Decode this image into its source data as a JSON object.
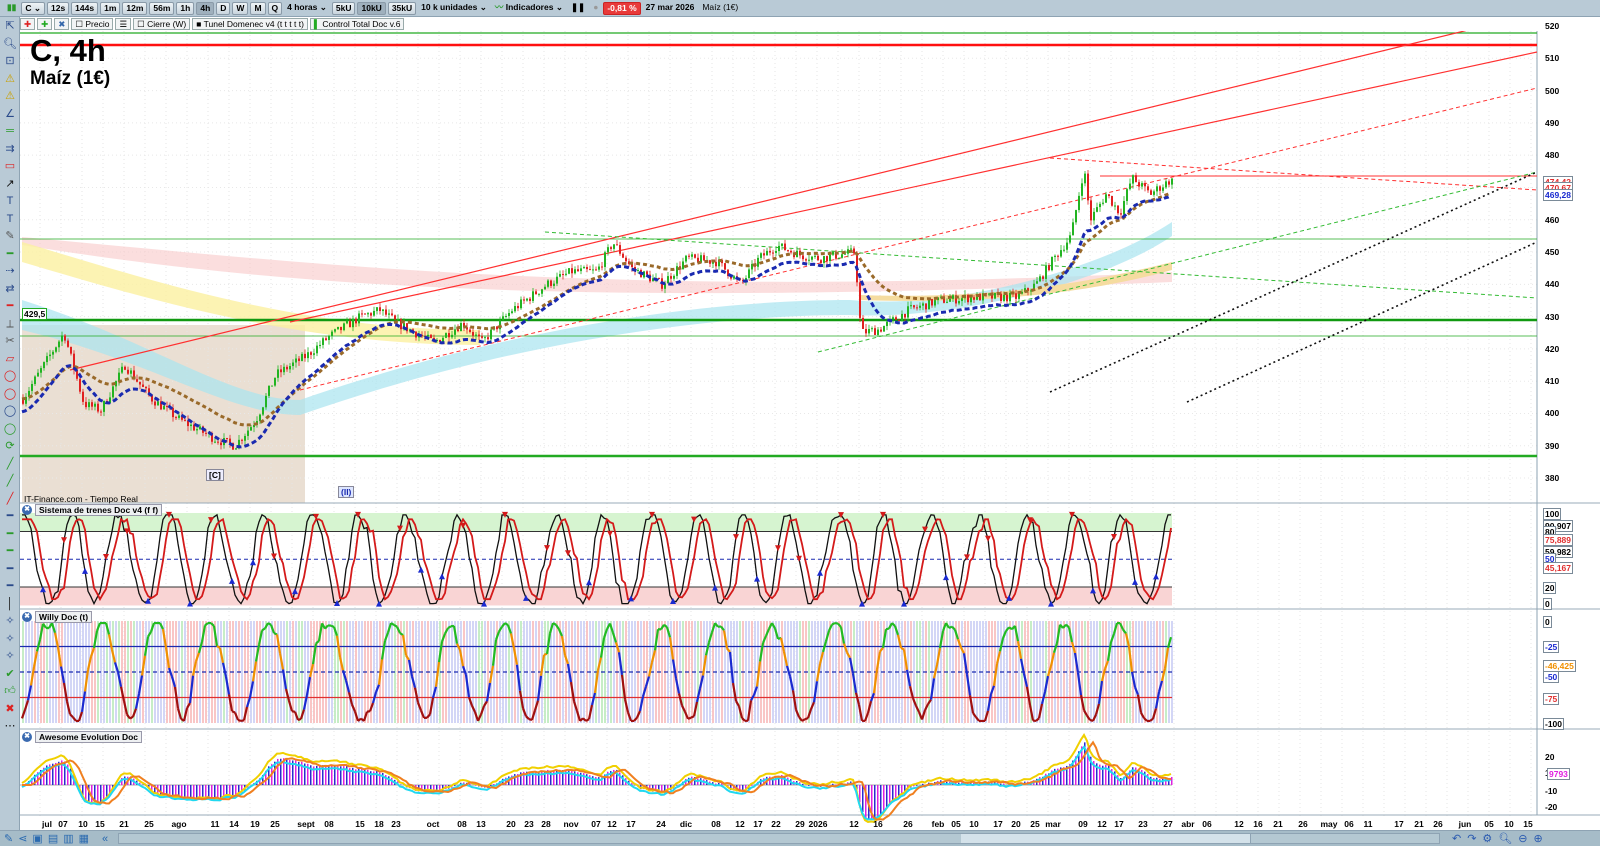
{
  "toolbar": {
    "symbol": "C",
    "intervals": [
      "12s",
      "144s",
      "1m",
      "12m",
      "56m",
      "1h",
      "4h",
      "D",
      "W",
      "M",
      "Q"
    ],
    "active_interval": "4h",
    "period": "4 horas",
    "volume_buttons": [
      "5kU",
      "10kU",
      "35kU"
    ],
    "active_volume": "10kU",
    "units": "10 k unidades",
    "indicators": "Indicadores",
    "change": "-0,81 %",
    "date": "27 mar 2026",
    "instrument": "Maíz (1€)"
  },
  "legend": {
    "items": [
      "Precio",
      "Cierre (W)",
      "Tunel Domenec v4 (t t t t t)",
      "Control Total Doc v.6"
    ]
  },
  "chart": {
    "title": "C, 4h",
    "subtitle": "Maíz (1€)",
    "source": "IT-Finance.com - Tiempo Real",
    "level_label": "429,5",
    "wave_labels": [
      "[C]",
      "(II)"
    ]
  },
  "panes": [
    "Sistema de trenes Doc v4 (f f)",
    "Willy Doc (t)",
    "Awesome Evolution Doc"
  ],
  "price_axis": {
    "ticks": [
      520,
      510,
      500,
      490,
      480,
      470,
      460,
      450,
      440,
      430,
      420,
      410,
      400,
      390,
      380
    ],
    "boxes": [
      {
        "text": "474,42",
        "color": "#e03030"
      },
      {
        "text": "470,67",
        "color": "#e03030"
      },
      {
        "text": "469,28",
        "color": "#1a2ad0"
      }
    ]
  },
  "pane1_axis": [
    "100",
    "90,907",
    "80",
    "75,889",
    "59,982",
    "50",
    "45,167",
    "20",
    "0"
  ],
  "pane2_axis": [
    "0",
    "-25",
    "-46,425",
    "-50",
    "-75",
    "-100"
  ],
  "pane3_axis": [
    "20",
    "10",
    "9793",
    "-10",
    "-20"
  ],
  "date_axis": [
    "jul",
    "07",
    "10",
    "15",
    "21",
    "25",
    "ago",
    "11",
    "14",
    "19",
    "25",
    "sept",
    "08",
    "15",
    "18",
    "23",
    "oct",
    "08",
    "13",
    "20",
    "23",
    "28",
    "nov",
    "07",
    "12",
    "17",
    "24",
    "dic",
    "08",
    "12",
    "17",
    "22",
    "29",
    "2026",
    "12",
    "16",
    "26",
    "feb",
    "05",
    "10",
    "17",
    "20",
    "25",
    "mar",
    "09",
    "12",
    "17",
    "23",
    "27",
    "abr",
    "06",
    "12",
    "16",
    "21",
    "26",
    "may",
    "06",
    "11",
    "17",
    "21",
    "26",
    "jun",
    "05",
    "10",
    "15"
  ],
  "colors": {
    "up": "#22b422",
    "down": "#e02020",
    "fast_ma": "#1a2ab0",
    "slow_ma": "#9a6a2a",
    "support": "#22aa22",
    "resistance": "#ff2020",
    "change_badge": "#e83a3a"
  },
  "chart_data": {
    "type": "candlestick",
    "ylim": [
      375,
      522
    ],
    "price_path": [
      [
        "2025-06-27",
        408
      ],
      [
        "2025-07-07",
        425
      ],
      [
        "2025-07-10",
        403
      ],
      [
        "2025-07-15",
        401
      ],
      [
        "2025-07-21",
        415
      ],
      [
        "2025-07-25",
        405
      ],
      [
        "2025-08-01",
        398
      ],
      [
        "2025-08-11",
        392
      ],
      [
        "2025-08-14",
        390
      ],
      [
        "2025-08-19",
        398
      ],
      [
        "2025-08-25",
        412
      ],
      [
        "2025-09-01",
        418
      ],
      [
        "2025-09-08",
        424
      ],
      [
        "2025-09-15",
        430
      ],
      [
        "2025-09-18",
        432
      ],
      [
        "2025-09-23",
        428
      ],
      [
        "2025-10-01",
        422
      ],
      [
        "2025-10-08",
        428
      ],
      [
        "2025-10-13",
        422
      ],
      [
        "2025-10-20",
        432
      ],
      [
        "2025-10-23",
        436
      ],
      [
        "2025-10-28",
        440
      ],
      [
        "2025-11-03",
        444
      ],
      [
        "2025-11-07",
        444
      ],
      [
        "2025-11-12",
        453
      ],
      [
        "2025-11-17",
        445
      ],
      [
        "2025-11-24",
        440
      ],
      [
        "2025-12-01",
        448
      ],
      [
        "2025-12-08",
        447
      ],
      [
        "2025-12-12",
        440
      ],
      [
        "2025-12-17",
        448
      ],
      [
        "2025-12-22",
        452
      ],
      [
        "2025-12-29",
        449
      ],
      [
        "2026-01-01",
        448
      ],
      [
        "2026-01-12",
        450
      ],
      [
        "2026-01-13",
        425
      ],
      [
        "2026-01-16",
        426
      ],
      [
        "2026-01-26",
        432
      ],
      [
        "2026-02-02",
        435
      ],
      [
        "2026-02-10",
        436
      ],
      [
        "2026-02-20",
        436
      ],
      [
        "2026-02-25",
        440
      ],
      [
        "2026-03-02",
        448
      ],
      [
        "2026-03-06",
        455
      ],
      [
        "2026-03-09",
        476
      ],
      [
        "2026-03-10",
        460
      ],
      [
        "2026-03-13",
        468
      ],
      [
        "2026-03-17",
        462
      ],
      [
        "2026-03-20",
        473
      ],
      [
        "2026-03-24",
        468
      ],
      [
        "2026-03-27",
        472
      ]
    ]
  }
}
